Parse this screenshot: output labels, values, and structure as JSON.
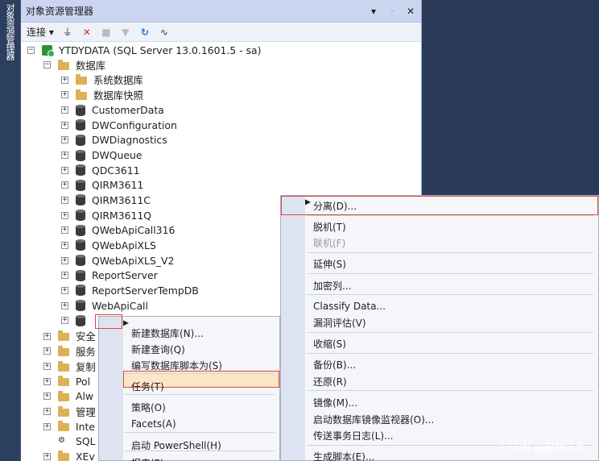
{
  "side_tab": {
    "label": "对象资源管理器"
  },
  "panel": {
    "title": "对象资源管理器",
    "title_buttons": [
      "▾",
      "ᆞ",
      "✕"
    ],
    "toolbar": {
      "connect_label": "连接 ▾",
      "icons": [
        "connect-plug-icon",
        "disconnect-plug-icon",
        "stop-icon",
        "filter-icon",
        "refresh-icon",
        "activity-monitor-icon"
      ]
    },
    "server": "YTDYDATA (SQL Server 13.0.1601.5 - sa)",
    "databases_folder": "数据库",
    "tree_items": [
      {
        "label": "系统数据库",
        "kind": "folder"
      },
      {
        "label": "数据库快照",
        "kind": "folder"
      },
      {
        "label": "CustomerData",
        "kind": "db"
      },
      {
        "label": "DWConfiguration",
        "kind": "db"
      },
      {
        "label": "DWDiagnostics",
        "kind": "db"
      },
      {
        "label": "DWQueue",
        "kind": "db"
      },
      {
        "label": "QDC3611",
        "kind": "db"
      },
      {
        "label": "QIRM3611",
        "kind": "db"
      },
      {
        "label": "QIRM3611C",
        "kind": "db"
      },
      {
        "label": "QIRM3611Q",
        "kind": "db"
      },
      {
        "label": "QWebApiCall316",
        "kind": "db"
      },
      {
        "label": "QWebApiXLS",
        "kind": "db"
      },
      {
        "label": "QWebApiXLS_V2",
        "kind": "db"
      },
      {
        "label": "ReportServer",
        "kind": "db"
      },
      {
        "label": "ReportServerTempDB",
        "kind": "db"
      },
      {
        "label": "WebApiCall",
        "kind": "db"
      },
      {
        "label": "",
        "kind": "db"
      }
    ],
    "top_items": [
      {
        "label": "安全",
        "kind": "folder"
      },
      {
        "label": "服务",
        "kind": "folder"
      },
      {
        "label": "复制",
        "kind": "folder"
      },
      {
        "label": "Pol",
        "kind": "folder"
      },
      {
        "label": "Alw",
        "kind": "folder"
      },
      {
        "label": "管理",
        "kind": "folder"
      },
      {
        "label": "Inte",
        "kind": "folder"
      },
      {
        "label": "SQL",
        "kind": "sql"
      },
      {
        "label": "XEv",
        "kind": "folder"
      }
    ]
  },
  "context_menu": {
    "items": [
      {
        "label": "新建数据库(N)...",
        "submenu": false
      },
      {
        "label": "新建查询(Q)",
        "submenu": false
      },
      {
        "label": "编写数据库脚本为(S)",
        "submenu": true
      },
      {
        "label": "任务(T)",
        "submenu": true
      },
      {
        "label": "策略(O)",
        "submenu": true
      },
      {
        "label": "Facets(A)",
        "submenu": false
      },
      {
        "label": "启动 PowerShell(H)",
        "submenu": false
      },
      {
        "label": "报表(P)",
        "submenu": true
      }
    ]
  },
  "submenu": {
    "items": [
      {
        "label": "分离(D)...",
        "submenu": false,
        "disabled": false
      },
      {
        "label": "脱机(T)",
        "submenu": false,
        "disabled": false
      },
      {
        "label": "联机(F)",
        "submenu": false,
        "disabled": true
      },
      {
        "label": "延伸(S)",
        "submenu": true,
        "disabled": false
      },
      {
        "label": "加密列...",
        "submenu": false,
        "disabled": false
      },
      {
        "label": "Classify Data...",
        "submenu": false,
        "disabled": false
      },
      {
        "label": "漏洞评估(V)",
        "submenu": true,
        "disabled": false
      },
      {
        "label": "收缩(S)",
        "submenu": true,
        "disabled": false
      },
      {
        "label": "备份(B)...",
        "submenu": false,
        "disabled": false
      },
      {
        "label": "还原(R)",
        "submenu": true,
        "disabled": false
      },
      {
        "label": "镜像(M)...",
        "submenu": false,
        "disabled": false
      },
      {
        "label": "启动数据库镜像监视器(O)...",
        "submenu": false,
        "disabled": false
      },
      {
        "label": "传送事务日志(L)...",
        "submenu": false,
        "disabled": false
      },
      {
        "label": "生成脚本(E)...",
        "submenu": false,
        "disabled": false
      }
    ]
  },
  "watermark": "CSDN @孤独半生",
  "colors": {
    "highlight_border": "#e2463a",
    "selected_fill": "#fbe6c8",
    "title_bar": "#ccd5f0"
  }
}
